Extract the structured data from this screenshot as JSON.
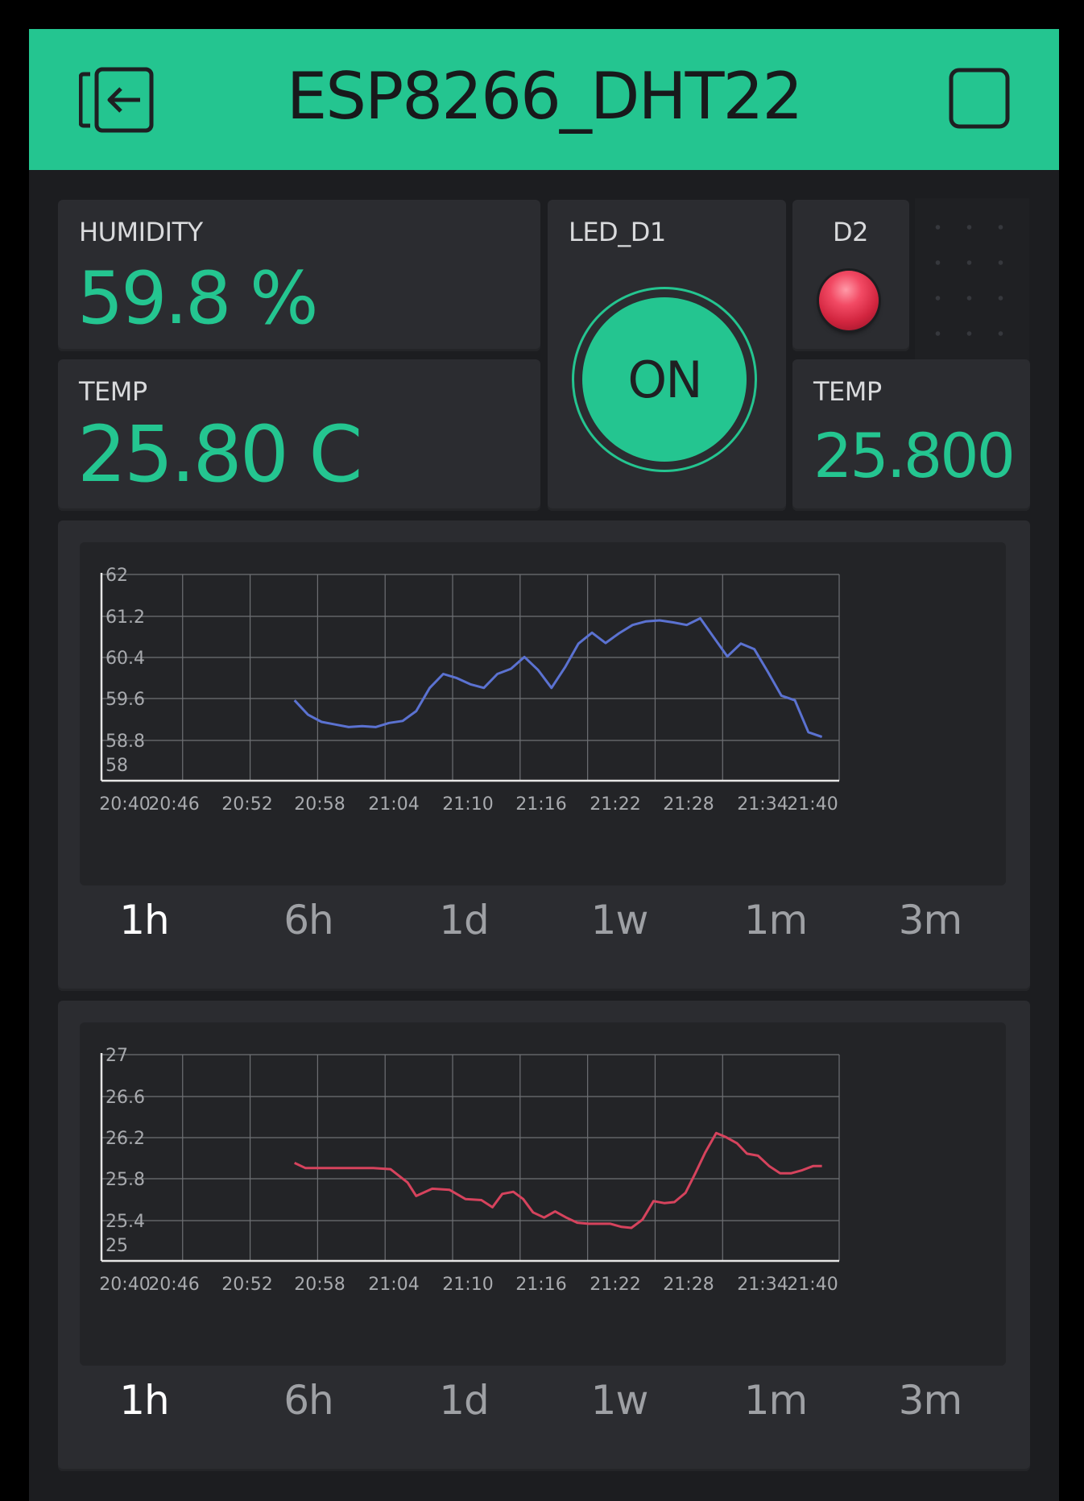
{
  "header": {
    "title": "ESP8266_DHT22",
    "back_icon": "exit-arrow-icon",
    "stop_icon": "stop-square-icon",
    "background": "#24c590"
  },
  "widgets": {
    "humidity": {
      "label": "HUMIDITY",
      "value": "59.8 %"
    },
    "temp": {
      "label": "TEMP",
      "value": "25.80 C"
    },
    "led_button": {
      "label": "LED_D1",
      "state_text": "ON"
    },
    "d2": {
      "label": "D2",
      "led_color": "#e8344f"
    },
    "temp_small": {
      "label": "TEMP",
      "value": "25.800"
    }
  },
  "periods": [
    "1h",
    "6h",
    "1d",
    "1w",
    "1m",
    "3m"
  ],
  "active_period": "1h",
  "accent_color": "#24c590",
  "chart_data": [
    {
      "type": "line",
      "x_ticks": [
        "20:40",
        "20:46",
        "20:52",
        "20:58",
        "21:04",
        "21:10",
        "21:16",
        "21:22",
        "21:28",
        "21:34",
        "21:40"
      ],
      "y_ticks": [
        "62",
        "61.2",
        "60.4",
        "59.6",
        "58.8",
        "58"
      ],
      "ylim": [
        58,
        62
      ],
      "xlim": [
        0,
        60
      ],
      "grid": true,
      "series": [
        {
          "color": "#5b72d1",
          "x": [
            15.7,
            16.8,
            17.9,
            19.0,
            20.1,
            21.2,
            22.3,
            23.4,
            24.5,
            25.6,
            26.7,
            27.8,
            28.9,
            30.0,
            31.1,
            32.2,
            33.3,
            34.4,
            35.5,
            36.6,
            37.7,
            38.8,
            39.9,
            41.0,
            42.1,
            43.2,
            44.3,
            45.4,
            46.5,
            47.6,
            48.7,
            49.8,
            50.9,
            52.0,
            53.1,
            54.2,
            55.3,
            56.4,
            57.5,
            58.6
          ],
          "y": [
            59.56,
            59.28,
            59.14,
            59.09,
            59.04,
            59.06,
            59.04,
            59.12,
            59.16,
            59.35,
            59.8,
            60.07,
            59.99,
            59.87,
            59.8,
            60.07,
            60.17,
            60.4,
            60.15,
            59.8,
            60.2,
            60.66,
            60.87,
            60.67,
            60.86,
            61.02,
            61.09,
            61.11,
            61.07,
            61.02,
            61.15,
            60.78,
            60.41,
            60.66,
            60.55,
            60.11,
            59.65,
            59.56,
            58.94,
            58.85
          ]
        }
      ]
    },
    {
      "type": "line",
      "x_ticks": [
        "20:40",
        "20:46",
        "20:52",
        "20:58",
        "21:04",
        "21:10",
        "21:16",
        "21:22",
        "21:28",
        "21:34",
        "21:40"
      ],
      "y_ticks": [
        "27",
        "26.6",
        "26.2",
        "25.8",
        "25.4",
        "25"
      ],
      "ylim": [
        25,
        27
      ],
      "xlim": [
        0,
        60
      ],
      "grid": true,
      "series": [
        {
          "color": "#d6435d",
          "x": [
            15.7,
            16.6,
            17.9,
            19.3,
            20.7,
            22.1,
            23.5,
            24.9,
            25.6,
            26.9,
            28.3,
            29.6,
            30.9,
            31.8,
            32.6,
            33.5,
            34.3,
            35.1,
            36.0,
            36.9,
            37.8,
            38.7,
            39.6,
            40.5,
            41.4,
            42.3,
            43.1,
            44.0,
            44.9,
            45.8,
            46.6,
            47.5,
            48.3,
            49.1,
            50.0,
            50.8,
            51.7,
            52.5,
            53.4,
            54.3,
            55.2,
            56.1,
            57.0,
            57.9,
            58.6
          ],
          "y": [
            25.95,
            25.9,
            25.9,
            25.9,
            25.9,
            25.9,
            25.89,
            25.76,
            25.63,
            25.7,
            25.69,
            25.6,
            25.59,
            25.52,
            25.65,
            25.67,
            25.6,
            25.47,
            25.42,
            25.48,
            25.42,
            25.37,
            25.36,
            25.36,
            25.36,
            25.33,
            25.32,
            25.4,
            25.58,
            25.56,
            25.57,
            25.66,
            25.85,
            26.05,
            26.24,
            26.2,
            26.14,
            26.04,
            26.02,
            25.92,
            25.85,
            25.85,
            25.88,
            25.92,
            25.92
          ]
        }
      ]
    }
  ]
}
